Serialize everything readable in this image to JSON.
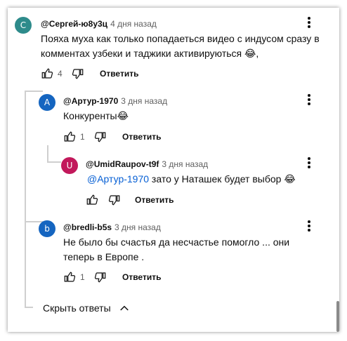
{
  "comments": [
    {
      "avatar_letter": "С",
      "avatar_color": "#2e8b8b",
      "author": "@Сергей-ю8у3ц",
      "time": "4 дня назад",
      "text": "Пояха муха как только попадаеться видео с индусом сразу в комментах узбеки и таджики активируються 😂,",
      "likes": "4",
      "reply_label": "Ответить"
    },
    {
      "avatar_letter": "A",
      "avatar_color": "#1565c0",
      "author": "@Артур-1970",
      "time": "3 дня назад",
      "text": "Конкуренты😂",
      "likes": "1",
      "reply_label": "Ответить"
    },
    {
      "avatar_letter": "U",
      "avatar_color": "#c2185b",
      "author": "@UmidRaupov-t9f",
      "time": "3 дня назад",
      "mention": "@Артур-1970",
      "text": " зато у Наташек будет выбор 😂",
      "likes": "",
      "reply_label": "Ответить"
    },
    {
      "avatar_letter": "b",
      "avatar_color": "#1565c0",
      "author": "@bredli-b5s",
      "time": "3 дня назад",
      "text": "Не было бы счастья да несчастье помогло ... они теперь в Европе .",
      "likes": "1",
      "reply_label": "Ответить"
    }
  ],
  "hide_replies_label": "Скрыть ответы",
  "icons": {
    "like": "thumb-up-icon",
    "dislike": "thumb-down-icon",
    "more": "more-vert-icon",
    "collapse": "chevron-up-icon"
  }
}
